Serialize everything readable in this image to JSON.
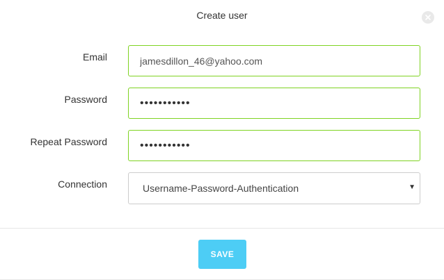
{
  "dialog": {
    "title": "Create user",
    "close_icon": "close-icon"
  },
  "form": {
    "email": {
      "label": "Email",
      "value": "jamesdillon_46@yahoo.com"
    },
    "password": {
      "label": "Password",
      "value": "•••••••••••"
    },
    "repeat_password": {
      "label": "Repeat Password",
      "value": "•••••••••••"
    },
    "connection": {
      "label": "Connection",
      "selected": "Username-Password-Authentication",
      "caret_icon": "chevron-down-icon"
    }
  },
  "footer": {
    "save_label": "SAVE"
  },
  "colors": {
    "valid_border": "#7ed321",
    "save_button": "#4dcdf5",
    "neutral_border": "#cccccc"
  }
}
